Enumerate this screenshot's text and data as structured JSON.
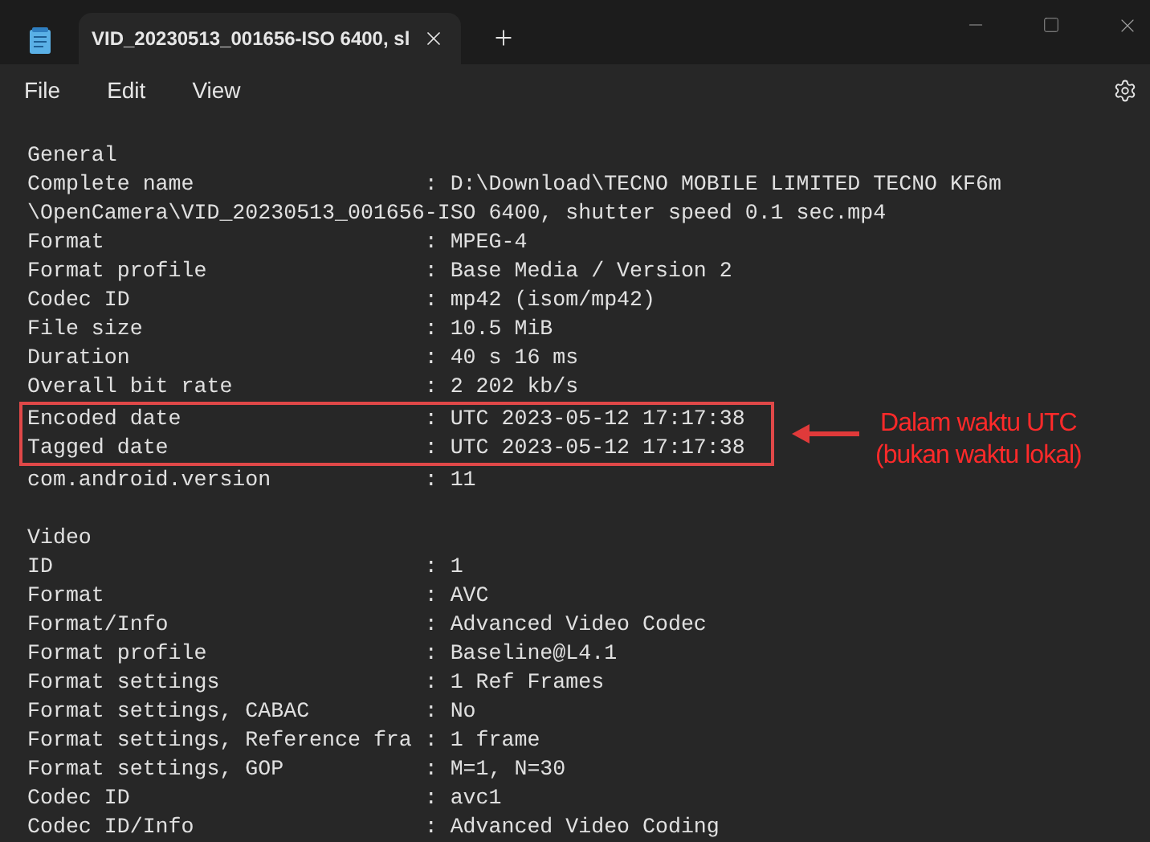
{
  "window": {
    "tab_title": "VID_20230513_001656-ISO 6400, sl"
  },
  "menu": [
    "File",
    "Edit",
    "View"
  ],
  "sections": [
    {
      "lines": [
        {
          "text": "General",
          "highlighted": false
        },
        {
          "text": "Complete name                  : D:\\Download\\TECNO MOBILE LIMITED TECNO KF6m",
          "highlighted": false
        },
        {
          "text": "\\OpenCamera\\VID_20230513_001656-ISO 6400, shutter speed 0.1 sec.mp4",
          "highlighted": false
        },
        {
          "text": "Format                         : MPEG-4",
          "highlighted": false
        },
        {
          "text": "Format profile                 : Base Media / Version 2",
          "highlighted": false
        },
        {
          "text": "Codec ID                       : mp42 (isom/mp42)",
          "highlighted": false
        },
        {
          "text": "File size                      : 10.5 MiB",
          "highlighted": false
        },
        {
          "text": "Duration                       : 40 s 16 ms",
          "highlighted": false
        },
        {
          "text": "Overall bit rate               : 2 202 kb/s",
          "highlighted": false
        },
        {
          "text": "Encoded date                   : UTC 2023-05-12 17:17:38",
          "highlighted": true
        },
        {
          "text": "Tagged date                    : UTC 2023-05-12 17:17:38",
          "highlighted": true
        },
        {
          "text": "com.android.version            : 11",
          "highlighted": false
        }
      ]
    },
    {
      "lines": [
        {
          "text": "Video",
          "highlighted": false
        },
        {
          "text": "ID                             : 1",
          "highlighted": false
        },
        {
          "text": "Format                         : AVC",
          "highlighted": false
        },
        {
          "text": "Format/Info                    : Advanced Video Codec",
          "highlighted": false
        },
        {
          "text": "Format profile                 : Baseline@L4.1",
          "highlighted": false
        },
        {
          "text": "Format settings                : 1 Ref Frames",
          "highlighted": false
        },
        {
          "text": "Format settings, CABAC         : No",
          "highlighted": false
        },
        {
          "text": "Format settings, Reference fra : 1 frame",
          "highlighted": false
        },
        {
          "text": "Format settings, GOP           : M=1, N=30",
          "highlighted": false
        },
        {
          "text": "Codec ID                       : avc1",
          "highlighted": false
        },
        {
          "text": "Codec ID/Info                  : Advanced Video Coding",
          "highlighted": false
        }
      ]
    }
  ],
  "annotation": [
    "Dalam waktu UTC",
    "(bukan waktu lokal)"
  ]
}
